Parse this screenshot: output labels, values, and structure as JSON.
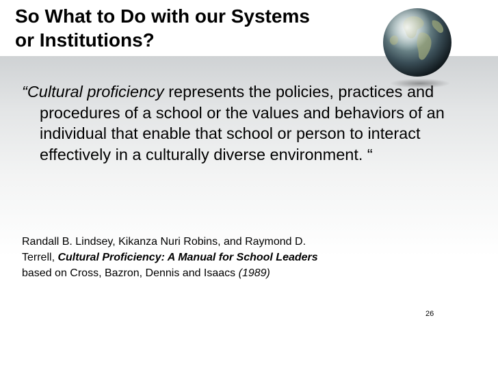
{
  "slide": {
    "title_line1": "So What to Do with our Systems",
    "title_line2": "or Institutions?",
    "quote": {
      "open_mark": "“",
      "emphasis": "Cultural proficiency",
      "body": " represents the policies, practices and procedures of a school or the values and behaviors of an individual that enable that school or person to interact effectively in a culturally diverse environment. “"
    },
    "citation": {
      "line1": "Randall B. Lindsey, Kikanza Nuri Robins, and Raymond D.",
      "line2_prefix": "Terrell, ",
      "book_title": "Cultural Proficiency: A Manual for School Leaders",
      "line3_prefix": "based on Cross, Bazron, Dennis and Isaacs ",
      "year": "(1989)"
    },
    "slide_number": "26"
  },
  "icons": {
    "globe": "earth-globe-icon"
  },
  "colors": {
    "text": "#000000",
    "background_gradient_top": "#cfd2d4",
    "background_gradient_bottom": "#ffffff"
  }
}
